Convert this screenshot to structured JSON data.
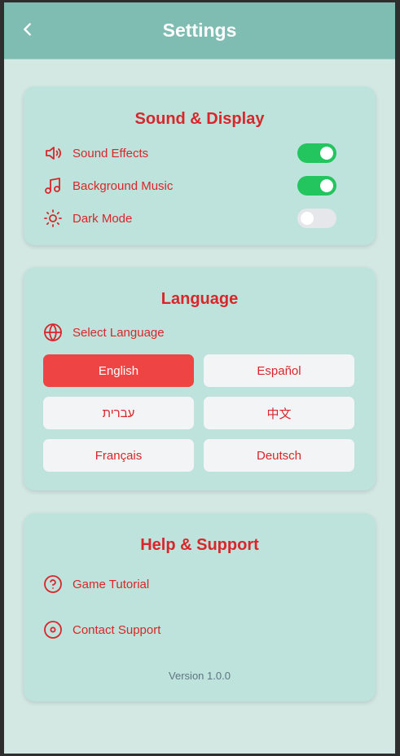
{
  "header": {
    "title": "Settings",
    "back_icon": "chevron-left-icon"
  },
  "sound_display": {
    "title": "Sound & Display",
    "items": [
      {
        "label": "Sound Effects",
        "icon": "speaker-icon",
        "enabled": true
      },
      {
        "label": "Background Music",
        "icon": "music-note-icon",
        "enabled": true
      },
      {
        "label": "Dark Mode",
        "icon": "sun-icon",
        "enabled": false
      }
    ]
  },
  "language": {
    "title": "Language",
    "select_label": "Select Language",
    "icon": "globe-icon",
    "options": [
      "English",
      "Español",
      "עברית",
      "中文",
      "Français",
      "Deutsch"
    ],
    "selected": "English"
  },
  "help": {
    "title": "Help & Support",
    "items": [
      {
        "label": "Game Tutorial",
        "icon": "question-circle-icon"
      },
      {
        "label": "Contact Support",
        "icon": "support-circle-icon"
      }
    ],
    "version": "Version 1.0.0"
  },
  "colors": {
    "accent": "#d9262a",
    "toggle_on": "#22c55e",
    "toggle_off": "#e5e7eb",
    "selected_language": "#ef4444",
    "header": "#7fbcb1",
    "card": "#bde3dc"
  }
}
